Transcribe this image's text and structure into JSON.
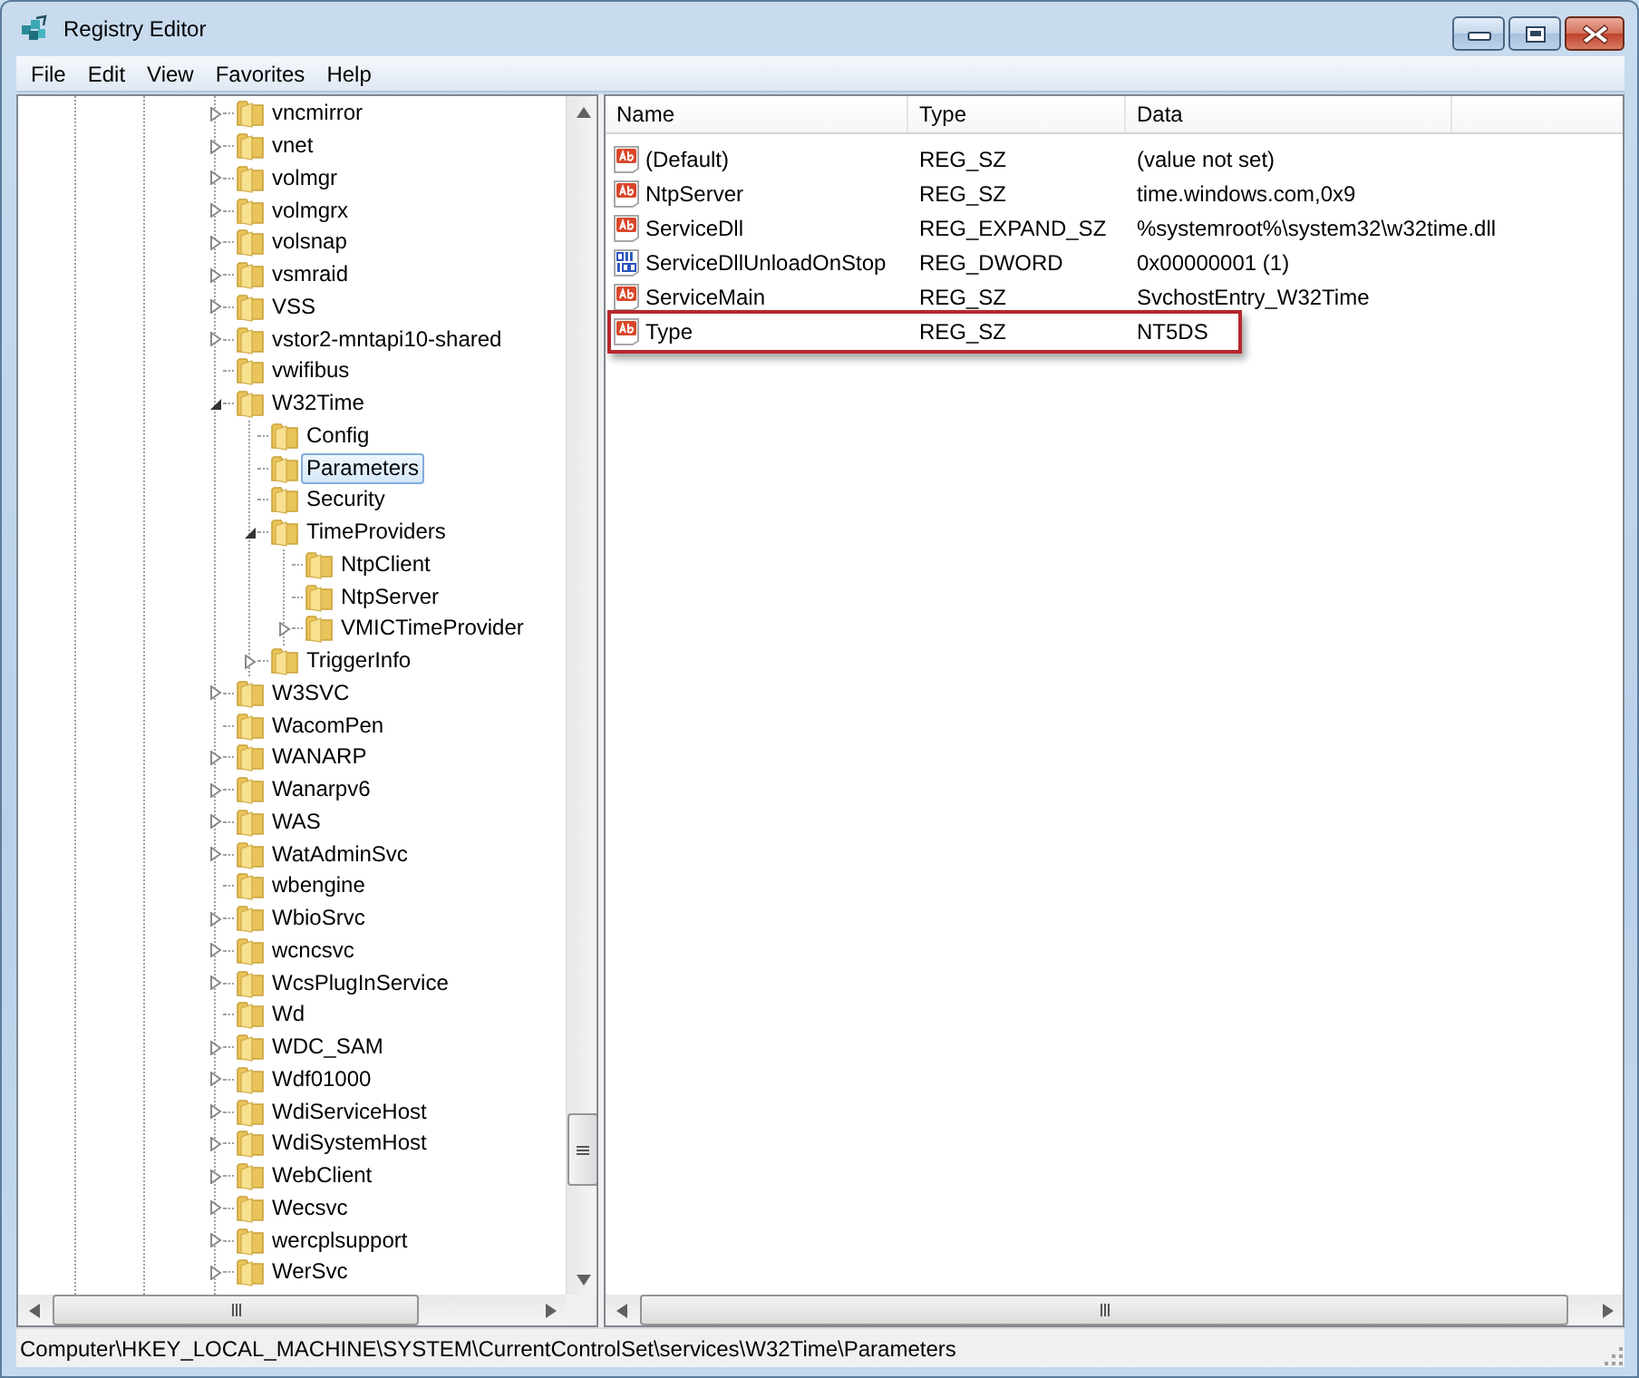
{
  "window": {
    "title": "Registry Editor"
  },
  "menu": [
    "File",
    "Edit",
    "View",
    "Favorites",
    "Help"
  ],
  "tree": {
    "items": [
      {
        "label": "vncmirror",
        "expandable": true,
        "expanded": false,
        "selected": false
      },
      {
        "label": "vnet",
        "expandable": true,
        "expanded": false,
        "selected": false
      },
      {
        "label": "volmgr",
        "expandable": true,
        "expanded": false,
        "selected": false
      },
      {
        "label": "volmgrx",
        "expandable": true,
        "expanded": false,
        "selected": false
      },
      {
        "label": "volsnap",
        "expandable": true,
        "expanded": false,
        "selected": false
      },
      {
        "label": "vsmraid",
        "expandable": true,
        "expanded": false,
        "selected": false
      },
      {
        "label": "VSS",
        "expandable": true,
        "expanded": false,
        "selected": false
      },
      {
        "label": "vstor2-mntapi10-shared",
        "expandable": true,
        "expanded": false,
        "selected": false
      },
      {
        "label": "vwifibus",
        "expandable": false,
        "expanded": false,
        "selected": false
      },
      {
        "label": "W32Time",
        "expandable": true,
        "expanded": true,
        "selected": false,
        "children": [
          {
            "label": "Config",
            "expandable": false,
            "expanded": false,
            "selected": false
          },
          {
            "label": "Parameters",
            "expandable": false,
            "expanded": false,
            "selected": true
          },
          {
            "label": "Security",
            "expandable": false,
            "expanded": false,
            "selected": false
          },
          {
            "label": "TimeProviders",
            "expandable": true,
            "expanded": true,
            "selected": false,
            "children": [
              {
                "label": "NtpClient",
                "expandable": false,
                "expanded": false,
                "selected": false
              },
              {
                "label": "NtpServer",
                "expandable": false,
                "expanded": false,
                "selected": false
              },
              {
                "label": "VMICTimeProvider",
                "expandable": true,
                "expanded": false,
                "selected": false
              }
            ]
          },
          {
            "label": "TriggerInfo",
            "expandable": true,
            "expanded": false,
            "selected": false
          }
        ]
      },
      {
        "label": "W3SVC",
        "expandable": true,
        "expanded": false,
        "selected": false
      },
      {
        "label": "WacomPen",
        "expandable": false,
        "expanded": false,
        "selected": false
      },
      {
        "label": "WANARP",
        "expandable": true,
        "expanded": false,
        "selected": false
      },
      {
        "label": "Wanarpv6",
        "expandable": true,
        "expanded": false,
        "selected": false
      },
      {
        "label": "WAS",
        "expandable": true,
        "expanded": false,
        "selected": false
      },
      {
        "label": "WatAdminSvc",
        "expandable": true,
        "expanded": false,
        "selected": false
      },
      {
        "label": "wbengine",
        "expandable": false,
        "expanded": false,
        "selected": false
      },
      {
        "label": "WbioSrvc",
        "expandable": true,
        "expanded": false,
        "selected": false
      },
      {
        "label": "wcncsvc",
        "expandable": true,
        "expanded": false,
        "selected": false
      },
      {
        "label": "WcsPlugInService",
        "expandable": true,
        "expanded": false,
        "selected": false
      },
      {
        "label": "Wd",
        "expandable": false,
        "expanded": false,
        "selected": false
      },
      {
        "label": "WDC_SAM",
        "expandable": true,
        "expanded": false,
        "selected": false
      },
      {
        "label": "Wdf01000",
        "expandable": true,
        "expanded": false,
        "selected": false
      },
      {
        "label": "WdiServiceHost",
        "expandable": true,
        "expanded": false,
        "selected": false
      },
      {
        "label": "WdiSystemHost",
        "expandable": true,
        "expanded": false,
        "selected": false
      },
      {
        "label": "WebClient",
        "expandable": true,
        "expanded": false,
        "selected": false
      },
      {
        "label": "Wecsvc",
        "expandable": true,
        "expanded": false,
        "selected": false
      },
      {
        "label": "wercplsupport",
        "expandable": true,
        "expanded": false,
        "selected": false
      },
      {
        "label": "WerSvc",
        "expandable": true,
        "expanded": false,
        "selected": false
      }
    ]
  },
  "values": {
    "columns": [
      "Name",
      "Type",
      "Data"
    ],
    "rows": [
      {
        "kind": "string",
        "name": "(Default)",
        "type": "REG_SZ",
        "data": "(value not set)",
        "highlighted": false
      },
      {
        "kind": "string",
        "name": "NtpServer",
        "type": "REG_SZ",
        "data": "time.windows.com,0x9",
        "highlighted": false
      },
      {
        "kind": "string",
        "name": "ServiceDll",
        "type": "REG_EXPAND_SZ",
        "data": "%systemroot%\\system32\\w32time.dll",
        "highlighted": false
      },
      {
        "kind": "dword",
        "name": "ServiceDllUnloadOnStop",
        "type": "REG_DWORD",
        "data": "0x00000001 (1)",
        "highlighted": false
      },
      {
        "kind": "string",
        "name": "ServiceMain",
        "type": "REG_SZ",
        "data": "SvchostEntry_W32Time",
        "highlighted": false
      },
      {
        "kind": "string",
        "name": "Type",
        "type": "REG_SZ",
        "data": "NT5DS",
        "highlighted": true
      }
    ]
  },
  "status_bar": "Computer\\HKEY_LOCAL_MACHINE\\SYSTEM\\CurrentControlSet\\services\\W32Time\\Parameters"
}
